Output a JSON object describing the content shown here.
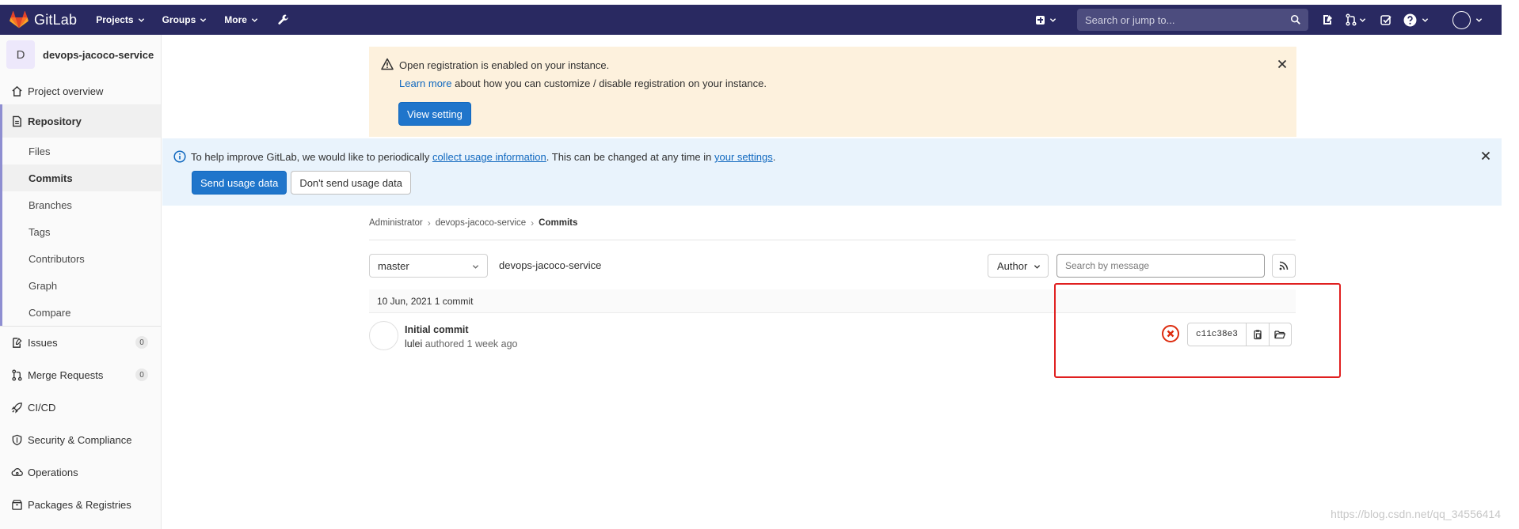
{
  "navbar": {
    "brand": "GitLab",
    "menu": [
      {
        "label": "Projects"
      },
      {
        "label": "Groups"
      },
      {
        "label": "More"
      }
    ],
    "search_placeholder": "Search or jump to...",
    "bg_color": "#292961"
  },
  "sidebar": {
    "project_initial": "D",
    "project_name": "devops-jacoco-service",
    "items": [
      {
        "label": "Project overview",
        "icon": "home-icon"
      },
      {
        "label": "Repository",
        "icon": "document-icon"
      },
      {
        "label": "Issues",
        "icon": "issues-icon",
        "count": "0"
      },
      {
        "label": "Merge Requests",
        "icon": "merge-request-icon",
        "count": "0"
      },
      {
        "label": "CI/CD",
        "icon": "rocket-icon"
      },
      {
        "label": "Security & Compliance",
        "icon": "shield-icon"
      },
      {
        "label": "Operations",
        "icon": "cloud-icon"
      },
      {
        "label": "Packages & Registries",
        "icon": "package-icon"
      }
    ],
    "repo_sub": [
      "Files",
      "Commits",
      "Branches",
      "Tags",
      "Contributors",
      "Graph",
      "Compare"
    ],
    "active_sub": "Commits"
  },
  "registration_banner": {
    "title": "Open registration is enabled on your instance.",
    "learn_more": "Learn more",
    "description": "about how you can customize / disable registration on your instance.",
    "button": "View setting"
  },
  "usage_banner": {
    "text_before": "To help improve GitLab, we would like to periodically",
    "link1": "collect usage information",
    "text_middle": ". This can be changed at any time in",
    "link2": "your settings",
    "text_after": ".",
    "primary_button": "Send usage data",
    "secondary_button": "Don't send usage data"
  },
  "breadcrumb": {
    "items": [
      "Administrator",
      "devops-jacoco-service",
      "Commits"
    ],
    "separator": "›"
  },
  "filters": {
    "branch": "master",
    "project": "devops-jacoco-service",
    "author_button": "Author",
    "search_placeholder": "Search by message"
  },
  "commits": {
    "day_header": "10 Jun, 2021 1 commit",
    "items": [
      {
        "title": "Initial commit",
        "author": "lulei",
        "meta": "authored 1 week ago",
        "sha": "c11c38e3",
        "pipeline_status": "failed"
      }
    ]
  },
  "watermark": "https://blog.csdn.net/qq_34556414"
}
